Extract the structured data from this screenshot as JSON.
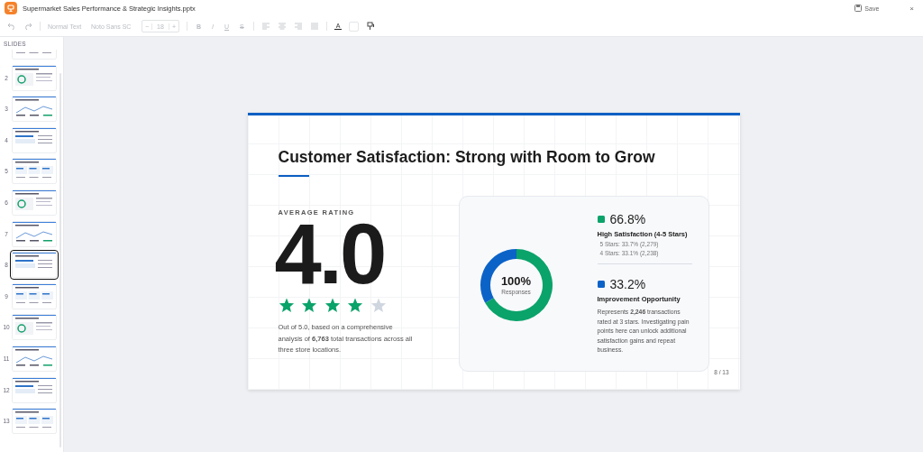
{
  "window": {
    "title": "Supermarket Sales Performance & Strategic Insights.pptx",
    "save": "Save",
    "close": "×"
  },
  "toolbar": {
    "disabled": true,
    "style": "Normal Text",
    "font": "Noto Sans SC",
    "minus": "−",
    "size": "18",
    "plus": "+",
    "format": [
      "B",
      "I",
      "U",
      "S"
    ],
    "color_label": "A"
  },
  "sidebar": {
    "title": "SLIDES",
    "slides": [
      {
        "selected": false
      },
      {
        "number": "2",
        "selected": false
      },
      {
        "number": "3",
        "selected": false
      },
      {
        "number": "4",
        "selected": false
      },
      {
        "number": "5",
        "selected": false
      },
      {
        "number": "6",
        "selected": false
      },
      {
        "number": "7",
        "selected": false
      },
      {
        "number": "8",
        "selected": true
      },
      {
        "number": "9",
        "selected": false
      },
      {
        "number": "10",
        "selected": false
      },
      {
        "number": "11",
        "selected": false
      },
      {
        "number": "12",
        "selected": false
      },
      {
        "number": "13",
        "selected": false
      }
    ]
  },
  "slide": {
    "title": "Customer Satisfaction: Strong with Room to Grow",
    "rating_label": "AVERAGE RATING",
    "rating": "4.0",
    "stars": 4,
    "rating_note": "Out of 5.0, based on a comprehensive analysis of **6,763** total transactions across all three store locations.",
    "donut": {
      "center_value": "100%",
      "center_label": "Responses",
      "chart_data": {
        "type": "donut",
        "values": [
          66.8,
          33.2
        ]
      }
    },
    "segments": [
      {
        "color": "#0aa36a",
        "percent": "66.8%",
        "label": "High Satisfaction (4-5 Stars)",
        "bullets": [
          "5 Stars: 33.7% (2,279)",
          "4 Stars: 33.1% (2,238)"
        ]
      },
      {
        "color": "#0b63c8",
        "percent": "33.2%",
        "label": "Improvement Opportunity",
        "text": "Represents **2,246** transactions rated at 3 stars. Investigating pain points here can unlock additional satisfaction gains and repeat business."
      }
    ],
    "page": "8 / 13"
  }
}
